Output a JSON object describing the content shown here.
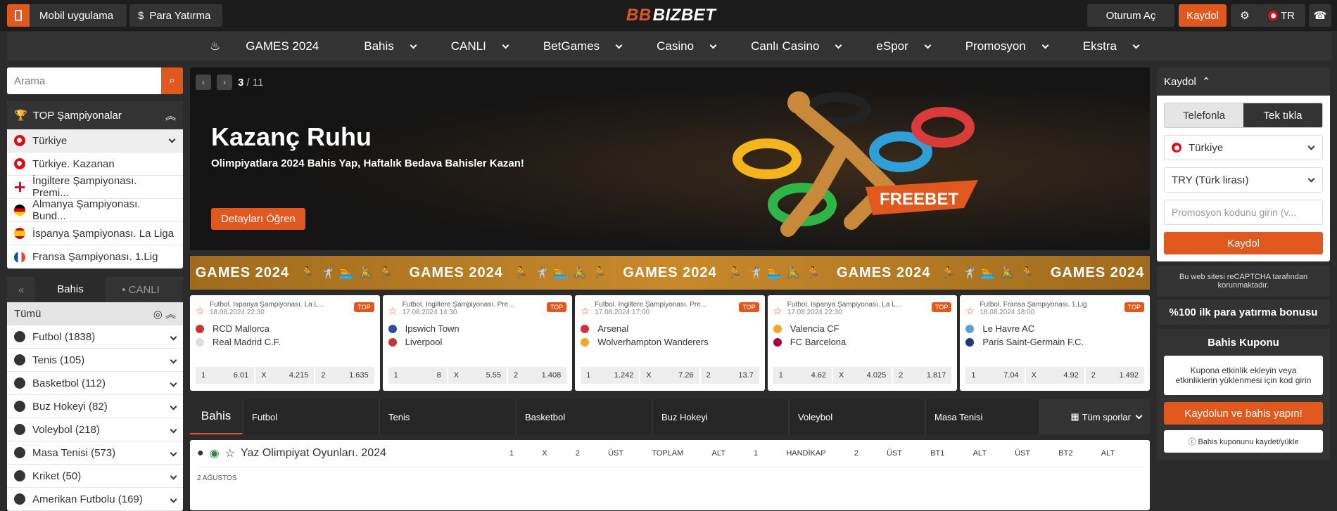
{
  "top": {
    "mobile": "Mobil uygulama",
    "deposit": "Para Yatırma",
    "logo": "BIZBET",
    "login": "Oturum Aç",
    "register": "Kaydol",
    "lang": "TR"
  },
  "nav": [
    "GAMES 2024",
    "Bahis",
    "CANLI",
    "BetGames",
    "Casino",
    "Canlı Casino",
    "eSpor",
    "Promosyon",
    "Ekstra"
  ],
  "search": {
    "placeholder": "Arama"
  },
  "top_champ": {
    "title": "TOP Şampiyonalar",
    "items": [
      "Türkiye",
      "Türkiye. Kazanan",
      "İngiltere Şampiyonası. Premi...",
      "Almanya Şampiyonası. Bund...",
      "İspanya Şampiyonası. La Liga",
      "Fransa Şampiyonası. 1.Lig"
    ]
  },
  "sports": {
    "tab_bahis": "Bahis",
    "tab_canli": "CANLI",
    "all": "Tümü",
    "items": [
      "Futbol (1838)",
      "Tenis (105)",
      "Basketbol (112)",
      "Buz Hokeyi (82)",
      "Voleybol (218)",
      "Masa Tenisi (573)",
      "Kriket (50)",
      "Amerikan Futbolu (169)"
    ]
  },
  "banner": {
    "page_current": "3",
    "page_total": "/ 11",
    "title": "Kazanç Ruhu",
    "subtitle": "Olimpiyatlara 2024 Bahis Yap, Haftalık Bedava Bahisler Kazan!",
    "button": "Detayları Öğren",
    "freebet": "FREEBET"
  },
  "games_strip": "GAMES 2024",
  "cards": [
    {
      "league": "Futbol. İspanya Şampiyonası. La L...",
      "date": "18.08.2024 22:30",
      "t1": "RCD Mallorca",
      "t2": "Real Madrid C.F.",
      "o1": "6.01",
      "ox": "4.215",
      "o2": "1.635"
    },
    {
      "league": "Futbol. İngiltere Şampiyonası. Pre...",
      "date": "17.08.2024 14:30",
      "t1": "Ipswich Town",
      "t2": "Liverpool",
      "o1": "8",
      "ox": "5.55",
      "o2": "1.408"
    },
    {
      "league": "Futbol. İngiltere Şampiyonası. Pre...",
      "date": "17.08.2024 17:00",
      "t1": "Arsenal",
      "t2": "Wolverhampton Wanderers",
      "o1": "1.242",
      "ox": "7.26",
      "o2": "13.7"
    },
    {
      "league": "Futbol. İspanya Şampiyonası. La L...",
      "date": "17.08.2024 22:30",
      "t1": "Valencia CF",
      "t2": "FC Barcelona",
      "o1": "4.62",
      "ox": "4.025",
      "o2": "1.817"
    },
    {
      "league": "Futbol. Fransa Şampiyonası. 1.Lig",
      "date": "18.08.2024 18:00",
      "t1": "Le Havre AC",
      "t2": "Paris Saint-Germain F.C.",
      "o1": "7.04",
      "ox": "4.92",
      "o2": "1.492"
    }
  ],
  "sportbar": {
    "label": "Bahis",
    "items": [
      "Futbol",
      "Tenis",
      "Basketbol",
      "Buz Hokeyi",
      "Voleybol",
      "Masa Tenisi"
    ],
    "all": "Tüm sporlar"
  },
  "match": {
    "title": "Yaz Olimpiyat Oyunları. 2024",
    "date": "2 AĞUSTOS",
    "cols": [
      "1",
      "X",
      "2",
      "ÜST",
      "TOPLAM",
      "ALT",
      "1",
      "HANDİKAP",
      "2",
      "ÜST",
      "BT1",
      "ALT",
      "ÜST",
      "BT2",
      "ALT"
    ]
  },
  "register": {
    "title": "Kaydol",
    "tab_phone": "Telefonla",
    "tab_one": "Tek tıkla",
    "country": "Türkiye",
    "currency": "TRY (Türk lirası)",
    "promo_placeholder": "Promosyon kodunu girin (v...",
    "button": "Kaydol",
    "recaptcha": "Bu web sitesi reCAPTCHA tarafından korunmaktadır.",
    "bonus": "%100  ilk para yatırma bonusu"
  },
  "coupon": {
    "title": "Bahis Kuponu",
    "text": "Kupona etkinlik ekleyin veya etkinliklerin yüklenmesi için kod girin",
    "button": "Kaydolun ve bahis yapın!",
    "save": "Bahis kuponunu kaydet/yükle"
  }
}
